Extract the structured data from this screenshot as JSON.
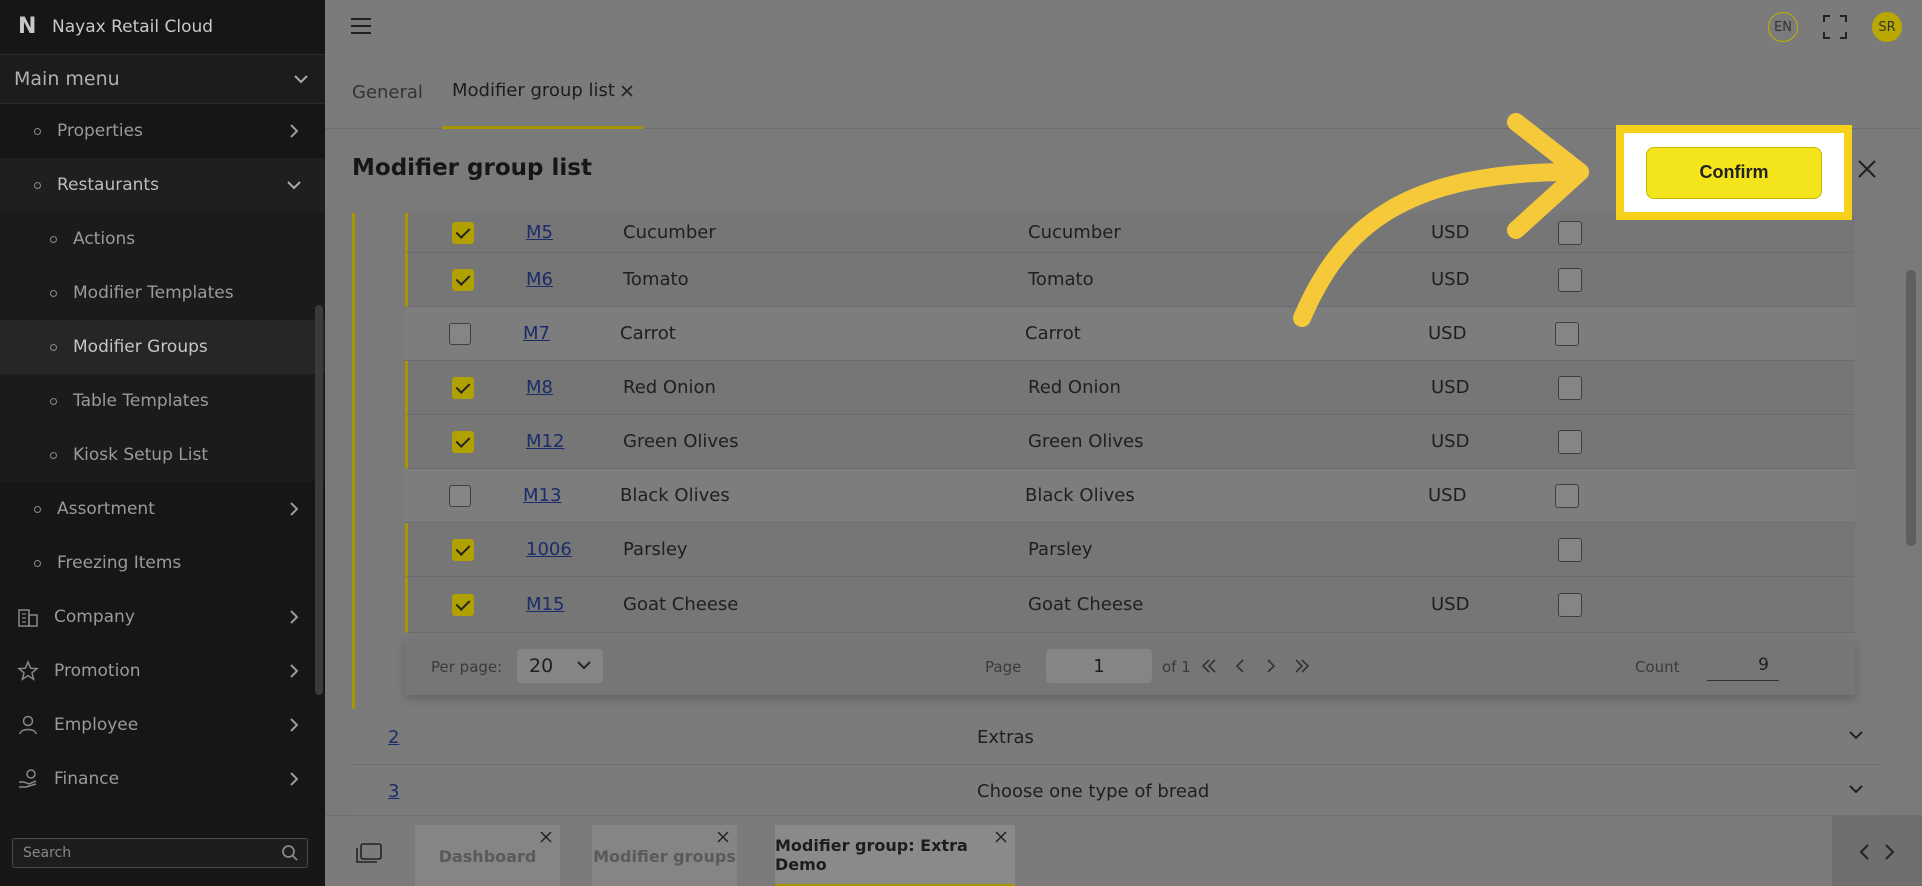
{
  "app": {
    "title": "Nayax Retail Cloud",
    "logo_letter": "N"
  },
  "sidebar": {
    "main_menu_label": "Main menu",
    "items": [
      {
        "label": "Properties"
      },
      {
        "label": "Restaurants"
      },
      {
        "label": "Actions"
      },
      {
        "label": "Modifier Templates"
      },
      {
        "label": "Modifier Groups"
      },
      {
        "label": "Table Templates"
      },
      {
        "label": "Kiosk Setup List"
      },
      {
        "label": "Assortment"
      },
      {
        "label": "Freezing Items"
      },
      {
        "label": "Company"
      },
      {
        "label": "Promotion"
      },
      {
        "label": "Employee"
      },
      {
        "label": "Finance"
      }
    ],
    "search_placeholder": "Search"
  },
  "topbar": {
    "language": "EN",
    "user_initials": "SR"
  },
  "tabs": [
    {
      "label": "General"
    },
    {
      "label": "Modifier group list"
    }
  ],
  "page": {
    "title": "Modifier group list",
    "confirm_label": "Confirm"
  },
  "table": {
    "rows": [
      {
        "checked": true,
        "code": "M5",
        "name": "Cucumber",
        "name2": "Cucumber",
        "currency": "USD"
      },
      {
        "checked": true,
        "code": "M6",
        "name": "Tomato",
        "name2": "Tomato",
        "currency": "USD"
      },
      {
        "checked": false,
        "code": "M7",
        "name": "Carrot",
        "name2": "Carrot",
        "currency": "USD"
      },
      {
        "checked": true,
        "code": "M8",
        "name": "Red Onion",
        "name2": "Red Onion",
        "currency": "USD"
      },
      {
        "checked": true,
        "code": "M12",
        "name": "Green Olives",
        "name2": "Green Olives",
        "currency": "USD"
      },
      {
        "checked": false,
        "code": "M13",
        "name": "Black Olives",
        "name2": "Black Olives",
        "currency": "USD"
      },
      {
        "checked": true,
        "code": "1006",
        "name": "Parsley",
        "name2": "Parsley",
        "currency": ""
      },
      {
        "checked": true,
        "code": "M15",
        "name": "Goat Cheese",
        "name2": "Goat Cheese",
        "currency": "USD"
      }
    ]
  },
  "pager": {
    "per_page_label": "Per page:",
    "per_page_value": "20",
    "page_label": "Page",
    "page_value": "1",
    "of_label": "of 1",
    "count_label": "Count",
    "count_value": "9"
  },
  "groups": [
    {
      "num": "2",
      "label": "Extras"
    },
    {
      "num": "3",
      "label": "Choose one type of bread"
    }
  ],
  "bottom_tabs": [
    {
      "label": "Dashboard"
    },
    {
      "label": "Modifier groups"
    },
    {
      "label": "Modifier group: Extra Demo"
    }
  ],
  "colors": {
    "accent": "#a89600",
    "confirm": "#f4e41c",
    "highlight": "#f6d11b",
    "sidebar": "#161616"
  }
}
